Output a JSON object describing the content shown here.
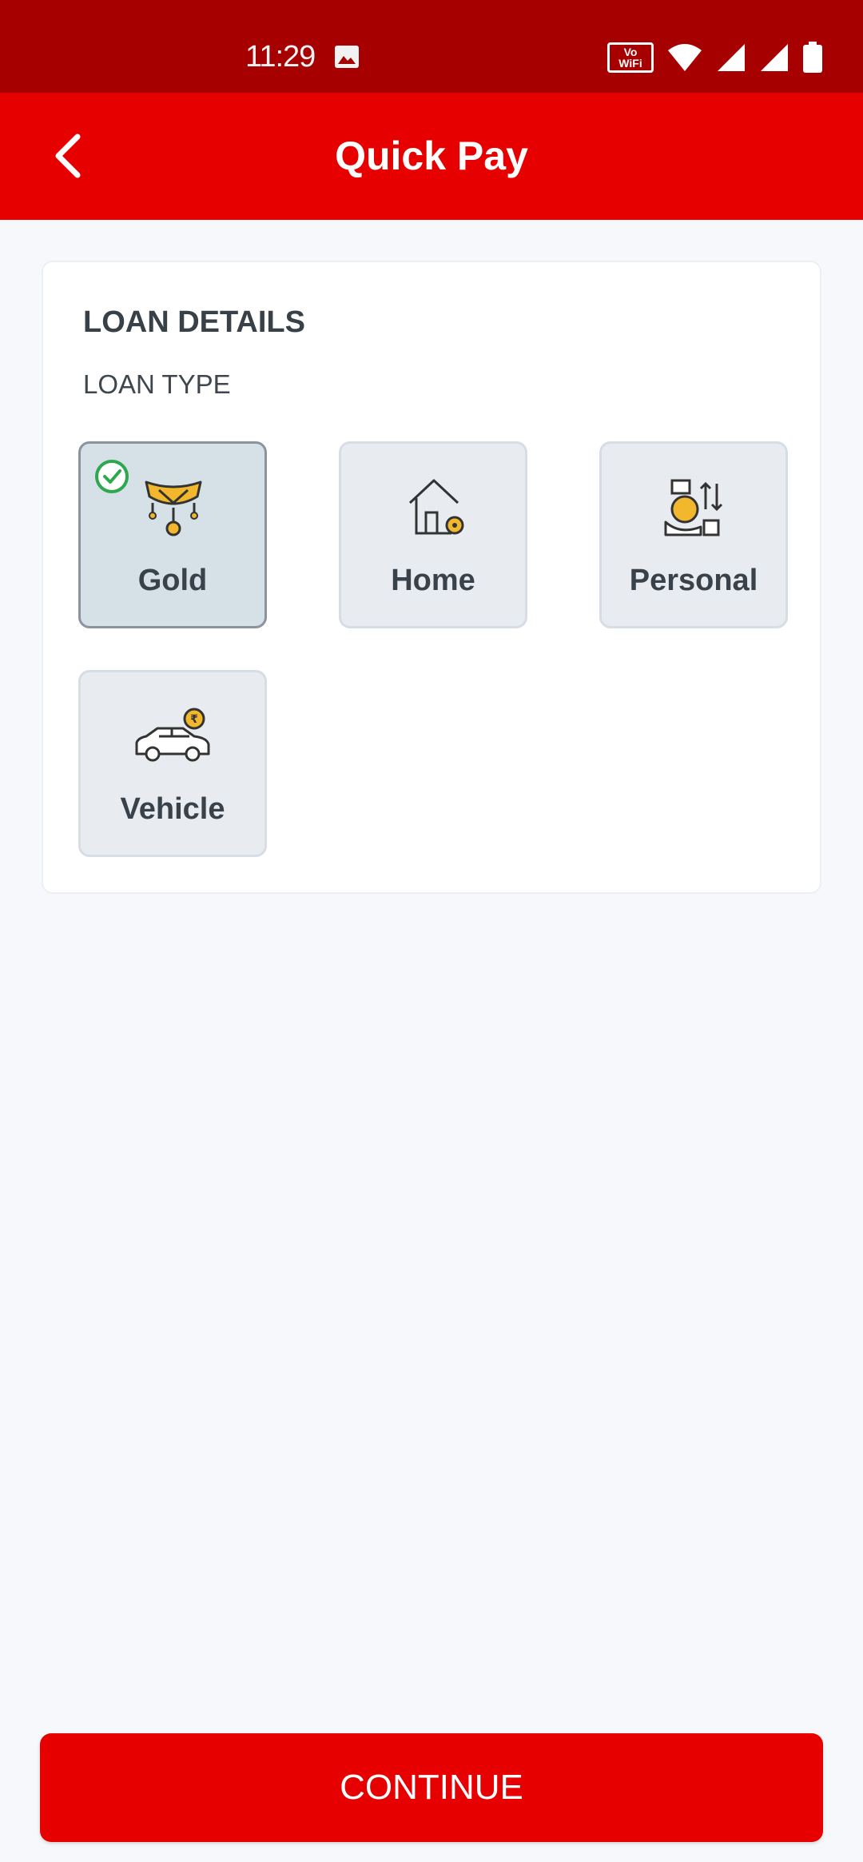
{
  "status_bar": {
    "time": "11:29",
    "vowifi_line1": "Vo",
    "vowifi_line2": "WiFi",
    "icons": [
      "photo-icon",
      "vowifi-icon",
      "wifi-icon",
      "signal-icon",
      "signal-icon",
      "battery-icon"
    ]
  },
  "header": {
    "title": "Quick Pay",
    "back_icon": "chevron-left-icon"
  },
  "loan_details": {
    "title": "LOAN DETAILS",
    "subtitle": "LOAN TYPE",
    "selected": "Gold",
    "tiles": [
      {
        "label": "Gold",
        "icon": "gold-necklace-icon"
      },
      {
        "label": "Home",
        "icon": "home-icon"
      },
      {
        "label": "Personal",
        "icon": "personal-loan-icon"
      },
      {
        "label": "Vehicle",
        "icon": "car-icon"
      }
    ]
  },
  "continue_label": "CONTINUE",
  "colors": {
    "brand_red": "#e60000",
    "status_bar_red": "#a60000",
    "accent_gold": "#f2b72c",
    "check_green": "#2ea84f"
  }
}
